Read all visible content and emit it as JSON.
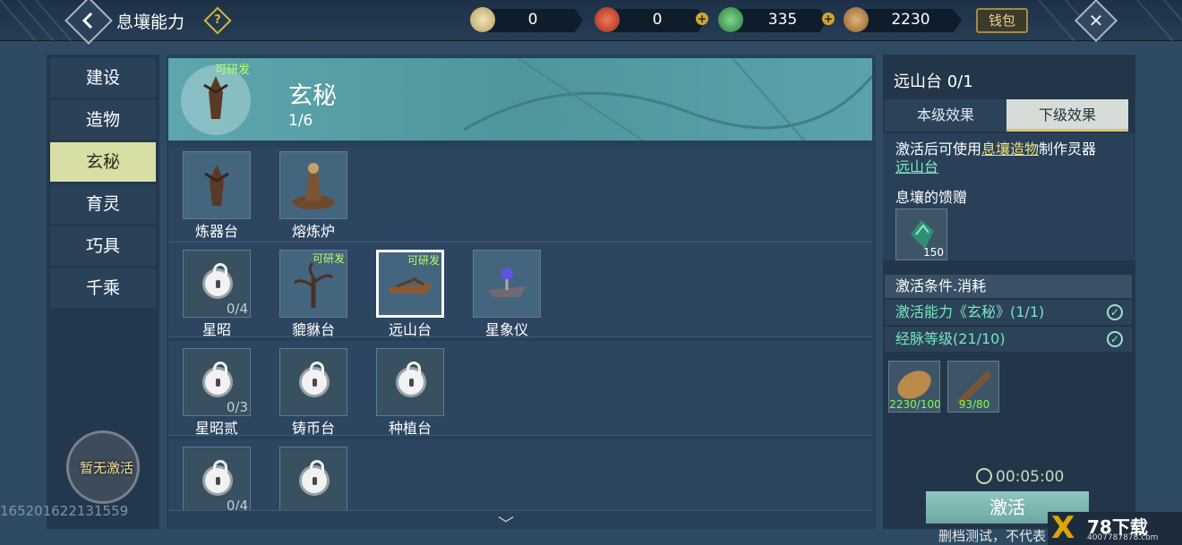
{
  "header": {
    "title": "息壤能力",
    "help_icon": "?",
    "wallet": "钱包",
    "currencies": [
      {
        "name": "jade-coin",
        "value": "0",
        "color": "#c9b77a"
      },
      {
        "name": "red-orb",
        "value": "0",
        "color": "#c63f2d"
      },
      {
        "name": "green-coil",
        "value": "335",
        "color": "#3aa957"
      },
      {
        "name": "seed",
        "value": "2230",
        "color": "#b98c4b"
      }
    ]
  },
  "nav": {
    "items": [
      "建设",
      "造物",
      "玄秘",
      "育灵",
      "巧具",
      "千乘"
    ],
    "active": "玄秘",
    "inactive_status": "暂无激活",
    "id_text": "165201622131559"
  },
  "banner": {
    "research": "可研发",
    "name": "玄秘",
    "count": "1/6"
  },
  "grid": {
    "research_tag": "可研发",
    "rows": [
      [
        {
          "name": "炼器台"
        },
        {
          "name": "熔炼炉"
        }
      ],
      [
        {
          "name": "星昭",
          "progress": "0/4",
          "locked": true
        },
        {
          "name": "貔貅台",
          "research": true
        },
        {
          "name": "远山台",
          "research": true,
          "selected": true
        },
        {
          "name": "星象仪"
        }
      ],
      [
        {
          "name": "星昭贰",
          "progress": "0/3",
          "locked": true
        },
        {
          "name": "铸币台",
          "locked": true
        },
        {
          "name": "种植台",
          "locked": true
        }
      ],
      [
        {
          "name": "",
          "progress": "0/4",
          "locked": true
        },
        {
          "name": "",
          "locked": true
        }
      ]
    ]
  },
  "detail": {
    "title": "远山台 0/1",
    "tabs": [
      "本级效果",
      "下级效果"
    ],
    "active_tab": "下级效果",
    "desc_prefix": "激活后可使用",
    "desc_link": "息壤造物",
    "desc_suffix": "制作灵器",
    "desc_link2": "远山台",
    "gift_title": "息壤的馈赠",
    "gift_qty": "150",
    "cond_title": "激活条件.消耗",
    "conditions": [
      {
        "text": "激活能力《玄秘》(1/1)"
      },
      {
        "text": "经脉等级(21/10)"
      }
    ],
    "costs": [
      {
        "count": "2230/100"
      },
      {
        "count": "93/80"
      }
    ],
    "timer": "00:05:00",
    "activate": "激活"
  },
  "footer": {
    "notice": "删档测试，不代表",
    "watermark_logo": "X",
    "watermark_title": "78下载",
    "watermark_url": "4007787878.com"
  }
}
